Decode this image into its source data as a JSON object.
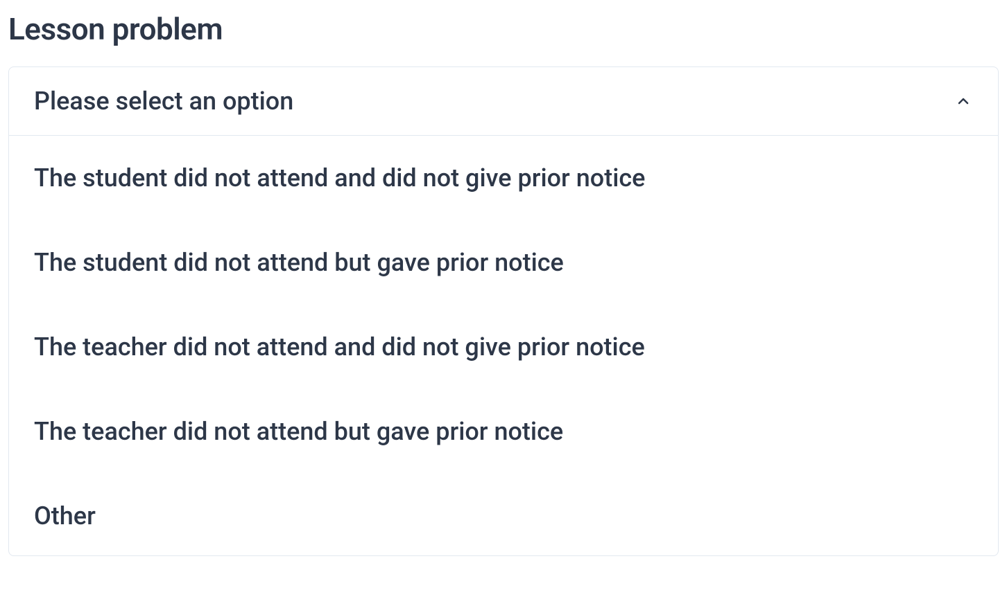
{
  "page": {
    "title": "Lesson problem"
  },
  "dropdown": {
    "placeholder": "Please select an option",
    "options": [
      {
        "label": "The student did not attend and did not give prior notice"
      },
      {
        "label": "The student did not attend but gave prior notice"
      },
      {
        "label": "The teacher did not attend and did not give prior notice"
      },
      {
        "label": "The teacher did not attend but gave prior notice"
      },
      {
        "label": "Other"
      }
    ]
  }
}
